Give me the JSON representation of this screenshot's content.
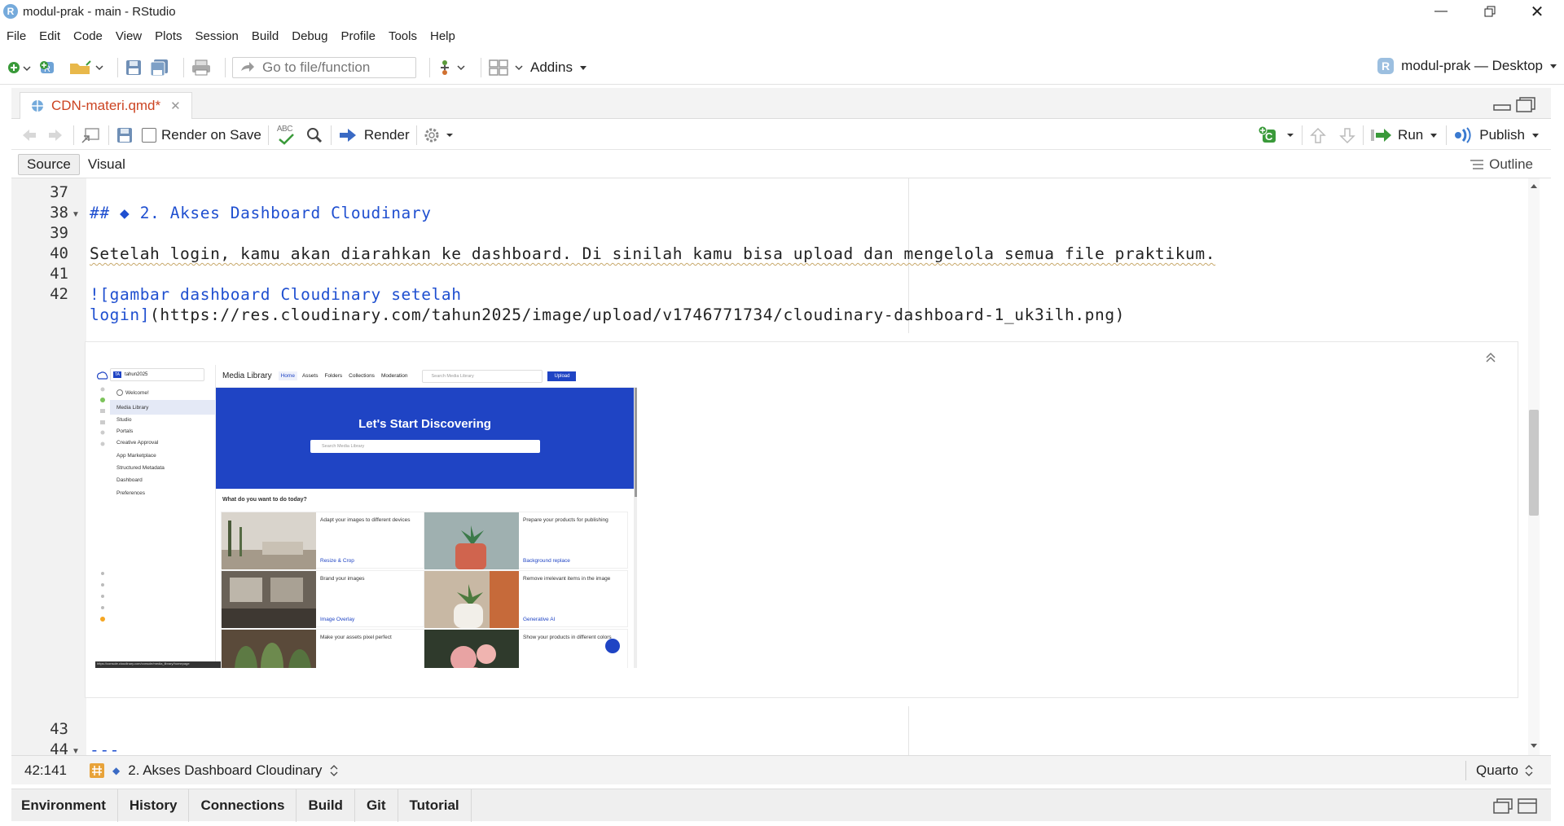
{
  "window": {
    "title": "modul-prak - main - RStudio",
    "app_glyph": "R"
  },
  "menu": [
    "File",
    "Edit",
    "Code",
    "View",
    "Plots",
    "Session",
    "Build",
    "Debug",
    "Profile",
    "Tools",
    "Help"
  ],
  "toolbar": {
    "goto_placeholder": "Go to file/function",
    "addins_label": "Addins",
    "project_label": "modul-prak — Desktop"
  },
  "editor_tab": {
    "filename": "CDN-materi.qmd*"
  },
  "editor_toolbar": {
    "render_on_save": "Render on Save",
    "render": "Render",
    "run": "Run",
    "publish": "Publish",
    "spell_icon_text": "ABC"
  },
  "mode": {
    "source": "Source",
    "visual": "Visual",
    "outline": "Outline"
  },
  "lines": [
    {
      "n": "37",
      "text": ""
    },
    {
      "n": "38",
      "text": "## ◆ 2. Akses Dashboard Cloudinary"
    },
    {
      "n": "39",
      "text": ""
    },
    {
      "n": "40",
      "text": "Setelah login, kamu akan diarahkan ke dashboard. Di sinilah kamu bisa upload dan mengelola semua file praktikum."
    },
    {
      "n": "41",
      "text": ""
    },
    {
      "n": "42",
      "text": "![gambar dashboard Cloudinary setelah"
    },
    {
      "n": "",
      "text": "login](https://res.cloudinary.com/tahun2025/image/upload/v1746771734/cloudinary-dashboard-1_uk3ilh.png)"
    },
    {
      "n": "43",
      "text": ""
    },
    {
      "n": "44",
      "text": "---"
    }
  ],
  "code": {
    "l38_a": "## ",
    "l38_b": "◆ 2. Akses Dashboard Cloudinary",
    "l40": "Setelah login, kamu akan diarahkan ke dashboard. Di sinilah kamu bisa upload dan mengelola semua file praktikum.",
    "l42_a": "![gambar dashboard Cloudinary setelah",
    "l42_b1": "login]",
    "l42_b2": "(https://res.cloudinary.com/tahun2025/image/upload/v1746771734/cloudinary-dashboard-1_uk3ilh.png)",
    "l44": "---"
  },
  "preview": {
    "sidebar": {
      "account": "tahun2025",
      "account_badge": "TA",
      "items": [
        "Welcome!",
        "Media Library",
        "Studio",
        "Portals",
        "Creative Approval",
        "App Marketplace",
        "Structured Metadata",
        "Dashboard",
        "Preferences"
      ]
    },
    "top": {
      "title": "Media Library",
      "tabs": [
        "Home",
        "Assets",
        "Folders",
        "Collections",
        "Moderation"
      ],
      "search": "Search Media Library",
      "upload": "Upload"
    },
    "hero": {
      "title": "Let's Start Discovering",
      "search": "Search Media Library"
    },
    "question": "What do you want to do today?",
    "cards": [
      {
        "text": "Adapt your images to different devices",
        "link": "Resize & Crop"
      },
      {
        "text": "Prepare your products for publishing",
        "link": "Background replace"
      },
      {
        "text": "Brand your images",
        "link": "Image Overlay"
      },
      {
        "text": "Remove irrelevant items in the image",
        "link": "Generative AI"
      },
      {
        "text": "Make your assets pixel perfect",
        "link": ""
      },
      {
        "text": "Show your products in different colors",
        "link": ""
      }
    ],
    "status_url": "https://console.cloudinary.com/console/media_library/homepage"
  },
  "status": {
    "pos": "42:141",
    "section": "2. Akses Dashboard Cloudinary",
    "filetype": "Quarto"
  },
  "bottom_tabs": [
    "Environment",
    "History",
    "Connections",
    "Build",
    "Git",
    "Tutorial"
  ]
}
